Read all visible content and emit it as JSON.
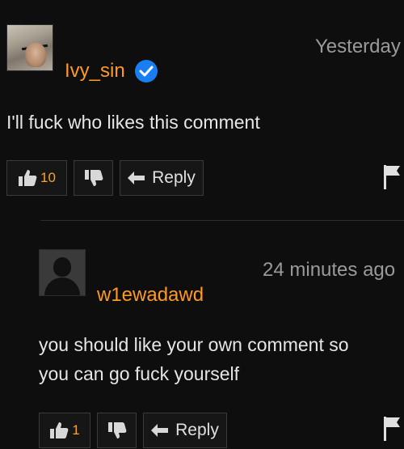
{
  "comments": [
    {
      "username": "Ivy_sin",
      "verified": true,
      "timestamp": "Yesterday",
      "text": "I'll fuck who likes this comment",
      "likes": "10",
      "reply_label": "Reply"
    },
    {
      "username": "w1ewadawd",
      "verified": false,
      "timestamp": "24 minutes ago",
      "text_line1": "you should like your own comment so",
      "text_line2": "you can go fuck yourself",
      "likes": "1",
      "reply_label": "Reply"
    }
  ],
  "colors": {
    "background": "#0e0e0e",
    "username": "#ff9a1f",
    "verified_badge": "#1a7ef3",
    "like_count": "#ffa31a"
  },
  "icons": [
    "thumbs-up-icon",
    "thumbs-down-icon",
    "reply-arrow-icon",
    "flag-icon",
    "verified-check-icon"
  ]
}
